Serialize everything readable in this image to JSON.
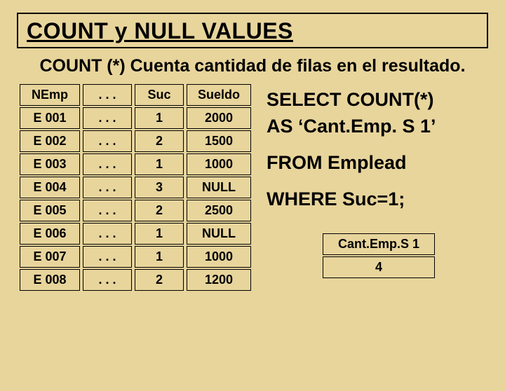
{
  "title": "COUNT y NULL VALUES",
  "subtitle": "COUNT (*) Cuenta cantidad de filas en el resultado.",
  "table": {
    "headers": [
      "NEmp",
      ". . .",
      "Suc",
      "Sueldo"
    ],
    "rows": [
      [
        "E 001",
        ". . .",
        "1",
        "2000"
      ],
      [
        "E 002",
        ". . .",
        "2",
        "1500"
      ],
      [
        "E 003",
        ". . .",
        "1",
        "1000"
      ],
      [
        "E 004",
        ". . .",
        "3",
        "NULL"
      ],
      [
        "E 005",
        ". . .",
        "2",
        "2500"
      ],
      [
        "E 006",
        ". . .",
        "1",
        "NULL"
      ],
      [
        "E 007",
        ". . .",
        "1",
        "1000"
      ],
      [
        "E 008",
        ". . .",
        "2",
        "1200"
      ]
    ]
  },
  "sql": {
    "line1": "SELECT COUNT(*)",
    "line2": "AS ‘Cant.Emp. S 1’",
    "line3": "FROM Emplead",
    "line4": "WHERE Suc=1;"
  },
  "result": {
    "header": "Cant.Emp.S 1",
    "value": "4"
  }
}
